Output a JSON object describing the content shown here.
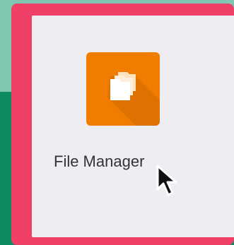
{
  "app": {
    "name": "File Manager",
    "icon": "folder-stack-icon",
    "icon_color": "#f07d00"
  },
  "colors": {
    "highlight": "#f04067",
    "tile_background": "#eeeef2",
    "desktop_top": "#7fc7b1",
    "desktop_bottom": "#0d8a62",
    "label_text": "#333333"
  },
  "cursor": {
    "icon": "mouse-pointer-icon"
  }
}
